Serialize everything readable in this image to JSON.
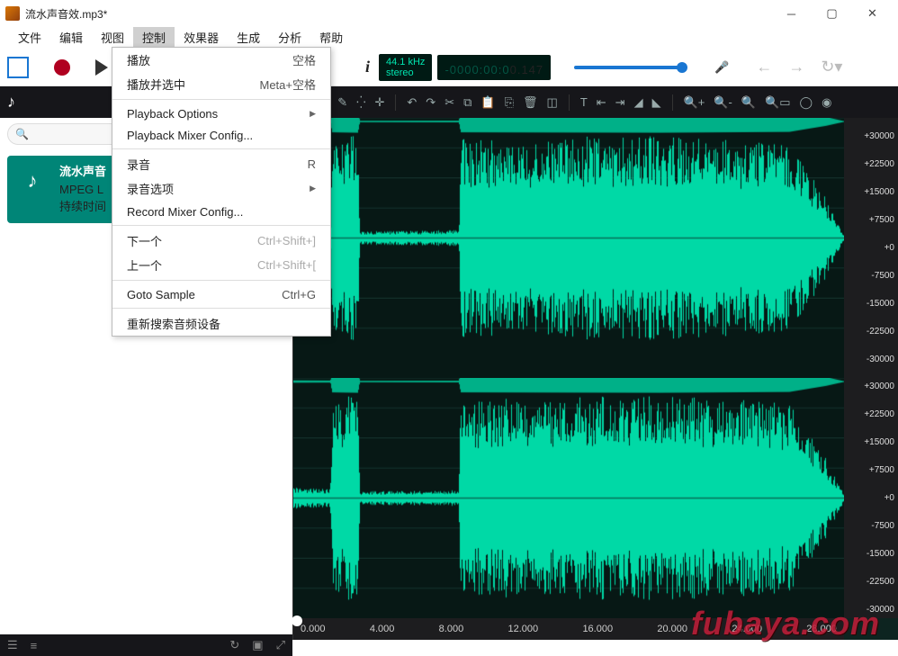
{
  "title": "流水声音效.mp3*",
  "menubar": [
    "文件",
    "编辑",
    "视图",
    "控制",
    "效果器",
    "生成",
    "分析",
    "帮助"
  ],
  "menu_active_idx": 3,
  "dropdown": {
    "items": [
      {
        "label": "播放",
        "shortcut": "空格"
      },
      {
        "label": "播放并选中",
        "shortcut": "Meta+空格"
      },
      {
        "sep": true
      },
      {
        "label": "Playback Options",
        "submenu": true
      },
      {
        "label": "Playback Mixer Config..."
      },
      {
        "sep": true
      },
      {
        "label": "录音",
        "shortcut": "R"
      },
      {
        "label": "录音选项",
        "submenu": true
      },
      {
        "label": "Record Mixer Config..."
      },
      {
        "sep": true
      },
      {
        "label": "下一个",
        "shortcut": "Ctrl+Shift+]",
        "disabled": true
      },
      {
        "label": "上一个",
        "shortcut": "Ctrl+Shift+[",
        "disabled": true
      },
      {
        "sep": true
      },
      {
        "label": "Goto Sample",
        "shortcut": "Ctrl+G"
      },
      {
        "sep": true
      },
      {
        "label": "重新搜索音频设备"
      }
    ]
  },
  "transport": {
    "info_icon": "i",
    "rate": "44.1 kHz",
    "channels": "stereo",
    "time_gray": "-0000:00:0",
    "time_bright": "0.147"
  },
  "toolbar_icons": [
    "cursor",
    "marquee",
    "pencil",
    "spray",
    "crosshair",
    "undo",
    "redo",
    "cut",
    "copy",
    "paste",
    "paste2",
    "trash",
    "crop",
    "text",
    "fit-left",
    "fit-right",
    "fade-in",
    "fade-out",
    "zoom-in",
    "zoom-out",
    "zoom-fit",
    "zoom-sel",
    "lasso",
    "lasso2"
  ],
  "search_placeholder": "",
  "track": {
    "name": "流水声音",
    "codec": "MPEG L",
    "duration": "持续时间"
  },
  "ruler_y": [
    "+30000",
    "+22500",
    "+15000",
    "+7500",
    "+0",
    "-7500",
    "-15000",
    "-22500",
    "-30000"
  ],
  "ruler_x": [
    "0.000",
    "4.000",
    "8.000",
    "12.000",
    "16.000",
    "20.000",
    "24.000",
    "28.000"
  ],
  "watermark": "fubaya.com",
  "chart_data": {
    "type": "waveform",
    "sample_rate": 44100,
    "channels": 2,
    "duration_sec": 30,
    "y_range": [
      -32768,
      32767
    ],
    "envelope_approx": [
      {
        "t": 0.0,
        "amp": 0.08
      },
      {
        "t": 2.0,
        "amp": 0.07
      },
      {
        "t": 2.1,
        "amp": 0.75
      },
      {
        "t": 3.5,
        "amp": 0.78
      },
      {
        "t": 3.6,
        "amp": 0.05
      },
      {
        "t": 9.0,
        "amp": 0.06
      },
      {
        "t": 9.1,
        "amp": 0.75
      },
      {
        "t": 20.0,
        "amp": 0.78
      },
      {
        "t": 27.0,
        "amp": 0.72
      },
      {
        "t": 29.0,
        "amp": 0.3
      },
      {
        "t": 30.0,
        "amp": 0.02
      }
    ]
  }
}
